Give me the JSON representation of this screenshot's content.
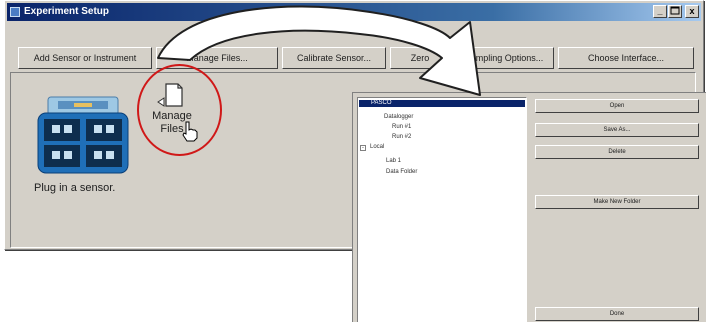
{
  "window": {
    "title": "Experiment Setup",
    "controls": {
      "minimize": "_",
      "maximize": "",
      "close": "x"
    }
  },
  "toolbar": {
    "buttons": [
      {
        "label": "Add Sensor or Instrument"
      },
      {
        "label": "Manage Files..."
      },
      {
        "label": "Calibrate Sensor..."
      },
      {
        "label": "Zero"
      },
      {
        "label": "Sampling Options..."
      },
      {
        "label": "Choose Interface..."
      }
    ]
  },
  "main": {
    "status": "Plug in a sensor.",
    "manage_files": {
      "label_line1": "Manage",
      "label_line2": "Files"
    }
  },
  "dialog": {
    "tree": [
      {
        "label": "PASCO",
        "selected": true,
        "expander": "-"
      },
      {
        "label": "Datalogger",
        "selected": false
      },
      {
        "label": "Run #1",
        "selected": false
      },
      {
        "label": "Run #2",
        "selected": false
      },
      {
        "label": "Local",
        "selected": false,
        "expander": "-"
      },
      {
        "label": "Lab 1",
        "selected": false
      },
      {
        "label": "Data Folder",
        "selected": false
      }
    ],
    "buttons": [
      {
        "label": "Open"
      },
      {
        "label": "Save As..."
      },
      {
        "label": "Delete"
      },
      {
        "label": "Make New Folder"
      },
      {
        "label": "Done"
      }
    ]
  }
}
